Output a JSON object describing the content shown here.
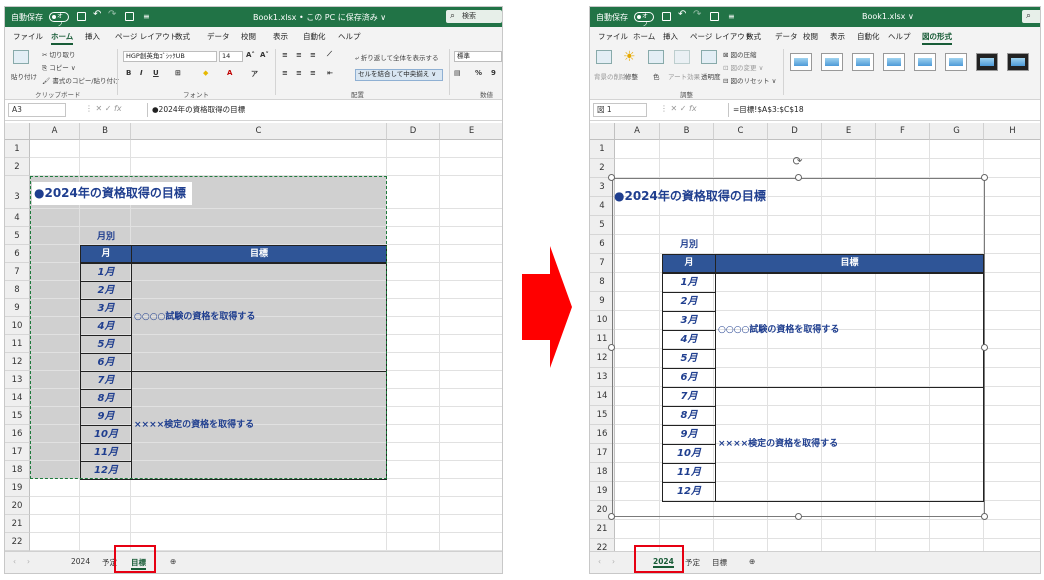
{
  "left": {
    "titlebar": {
      "autosave": "自動保存",
      "toggle": "オフ",
      "filename": "Book1.xlsx • この PC に保存済み ∨",
      "search": "検索"
    },
    "menu": [
      "ファイル",
      "ホーム",
      "挿入",
      "ページ レイアウト",
      "数式",
      "データ",
      "校閲",
      "表示",
      "自動化",
      "ヘルプ"
    ],
    "active_menu": "ホーム",
    "ribbon": {
      "paste": "貼り付け",
      "cut": "切り取り",
      "copy": "コピー ∨",
      "format_painter": "書式のコピー/貼り付け",
      "clipboard_group": "クリップボード",
      "font_name": "HGP創英角ｺﾞｼｯｸUB",
      "font_size": "14",
      "grow": "A˄",
      "shrink": "A˅",
      "bold": "B",
      "italic": "I",
      "underline": "U",
      "font_group": "フォント",
      "wrap_text": "折り返して全体を表示する",
      "merge_center": "セルを結合して中央揃え",
      "align_group": "配置",
      "number_format": "標準",
      "number_group": "数値",
      "percent": "%"
    },
    "namebox": "A3",
    "formula": "●2024年の資格取得の目標",
    "columns": [
      "A",
      "B",
      "C",
      "D",
      "E"
    ],
    "rows": [
      "1",
      "2",
      "3",
      "4",
      "5",
      "6",
      "7",
      "8",
      "9",
      "10",
      "11",
      "12",
      "13",
      "14",
      "15",
      "16",
      "17",
      "18",
      "19",
      "20",
      "21",
      "22"
    ],
    "sheet_title": "●2024年の資格取得の目標",
    "label_monthly": "月別",
    "header_month": "月",
    "header_goal": "目標",
    "months": [
      "1月",
      "2月",
      "3月",
      "4月",
      "5月",
      "6月",
      "7月",
      "8月",
      "9月",
      "10月",
      "11月",
      "12月"
    ],
    "goal1": "○○○○試験の資格を取得する",
    "goal2": "××××検定の資格を取得する",
    "tabs": [
      "2024",
      "予定",
      "目標"
    ],
    "active_tab": "目標"
  },
  "right": {
    "titlebar": {
      "autosave": "自動保存",
      "toggle": "オフ",
      "filename": "Book1.xlsx ∨"
    },
    "menu": [
      "ファイル",
      "ホーム",
      "挿入",
      "ページ レイアウト",
      "数式",
      "データ",
      "校閲",
      "表示",
      "自動化",
      "ヘルプ",
      "図の形式"
    ],
    "active_menu": "図の形式",
    "ribbon": {
      "remove_bg": "背景の削除",
      "corrections": "修整",
      "color": "色",
      "artistic": "アート効果",
      "transparency": "透明度",
      "compress": "図の圧縮",
      "change_picture": "図の変更 ∨",
      "reset_picture": "図のリセット ∨",
      "adjust_group": "調整"
    },
    "namebox": "図 1",
    "formula": "=目標!$A$3:$C$18",
    "columns": [
      "A",
      "B",
      "C",
      "D",
      "E",
      "F",
      "G",
      "H"
    ],
    "rows": [
      "1",
      "2",
      "3",
      "4",
      "5",
      "6",
      "7",
      "8",
      "9",
      "10",
      "11",
      "12",
      "13",
      "14",
      "15",
      "16",
      "17",
      "18",
      "19",
      "20",
      "21",
      "22"
    ],
    "sheet_title": "●2024年の資格取得の目標",
    "label_monthly": "月別",
    "header_month": "月",
    "header_goal": "目標",
    "months": [
      "1月",
      "2月",
      "3月",
      "4月",
      "5月",
      "6月",
      "7月",
      "8月",
      "9月",
      "10月",
      "11月",
      "12月"
    ],
    "goal1": "○○○○試験の資格を取得する",
    "goal2": "××××検定の資格を取得する",
    "tabs": [
      "2024",
      "予定",
      "目標"
    ],
    "active_tab": "2024"
  },
  "colors": {
    "excel_green": "#217346",
    "header_blue": "#2f5597",
    "text_blue": "#1f3e8f",
    "highlight_red": "#e60012",
    "arrow_red": "#ff0000"
  }
}
